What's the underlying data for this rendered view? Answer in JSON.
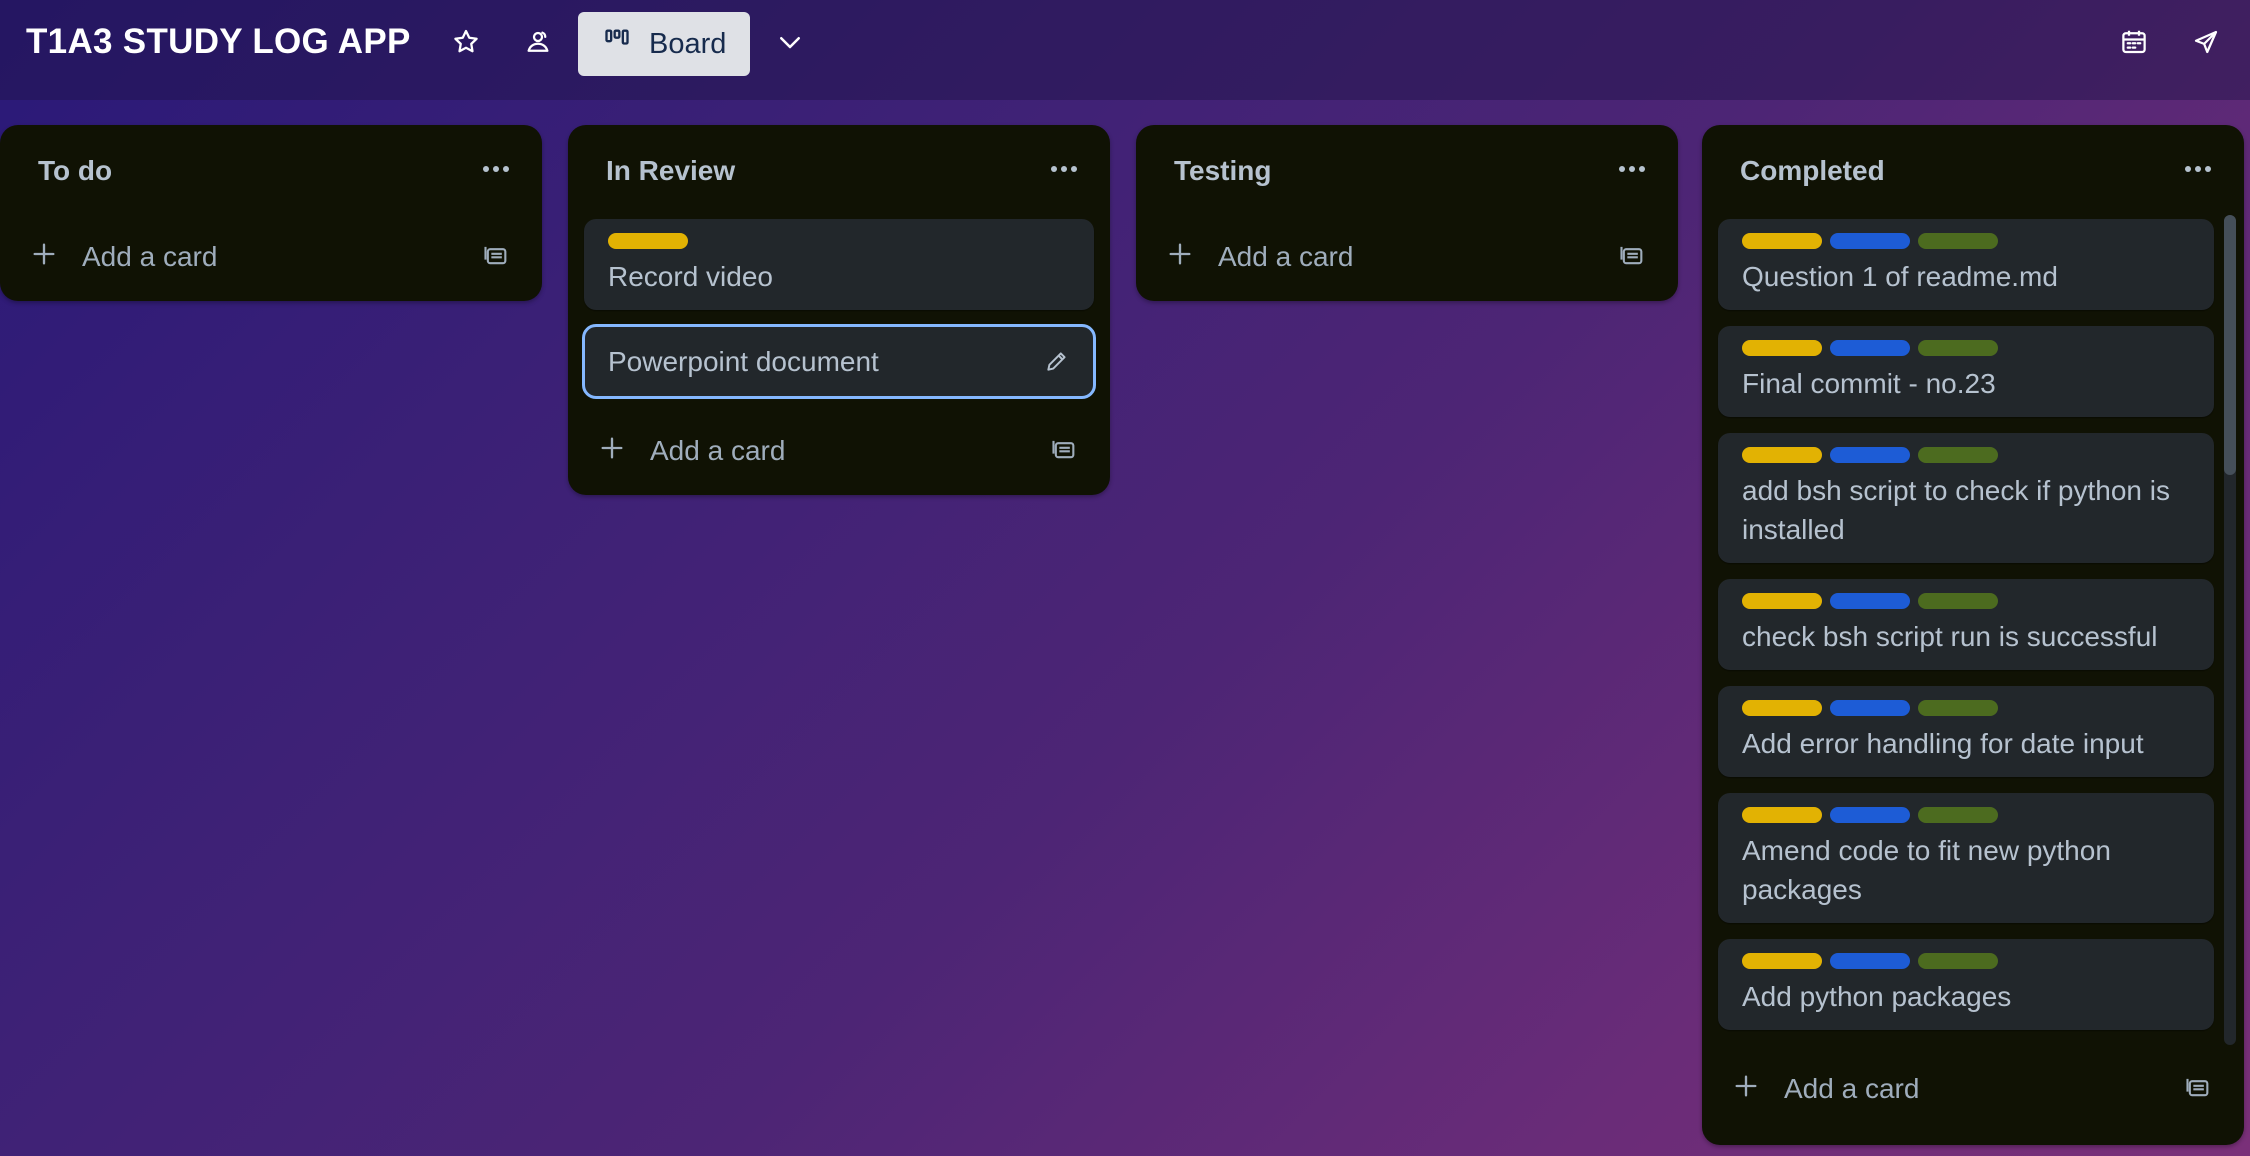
{
  "header": {
    "board_title": "T1A3 STUDY LOG APP",
    "view_label": "Board",
    "icons": [
      "star-icon",
      "workspace-visibility-icon",
      "board-view-icon",
      "chevron-down-icon",
      "calendar-icon",
      "power-ups-icon"
    ]
  },
  "colors": {
    "label_yellow": "#e2b203",
    "label_blue": "#1d5cd6",
    "label_green": "#4c6b1f",
    "list_bg": "#101204",
    "card_bg": "#22272b",
    "editing_outline": "#85b8ff"
  },
  "add_card_label": "Add a card",
  "lists": [
    {
      "title": "To do",
      "cards": []
    },
    {
      "title": "In Review",
      "cards": [
        {
          "text": "Record video",
          "labels": [
            "yellow"
          ]
        },
        {
          "text": "Powerpoint document",
          "labels": [],
          "editing": true
        }
      ]
    },
    {
      "title": "Testing",
      "cards": []
    },
    {
      "title": "Completed",
      "cards": [
        {
          "text": "Question 1 of readme.md",
          "labels": [
            "yellow",
            "blue",
            "green"
          ]
        },
        {
          "text": "Final commit - no.23",
          "labels": [
            "yellow",
            "blue",
            "green"
          ]
        },
        {
          "text": "add bsh script to check if python is installed",
          "labels": [
            "yellow",
            "blue",
            "green"
          ]
        },
        {
          "text": "check bsh script run is successful",
          "labels": [
            "yellow",
            "blue",
            "green"
          ]
        },
        {
          "text": "Add error handling for date input",
          "labels": [
            "yellow",
            "blue",
            "green"
          ]
        },
        {
          "text": "Amend code to fit new python packages",
          "labels": [
            "yellow",
            "blue",
            "green"
          ]
        },
        {
          "text": "Add python packages",
          "labels": [
            "yellow",
            "blue",
            "green"
          ]
        }
      ]
    }
  ]
}
